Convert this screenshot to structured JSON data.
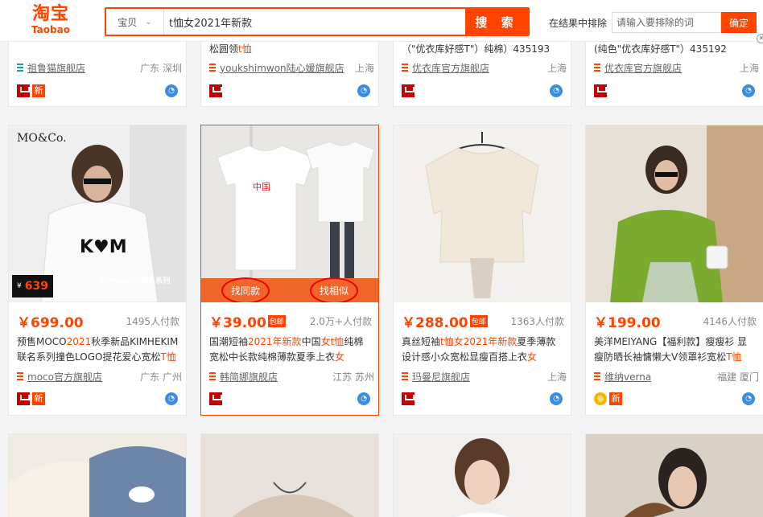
{
  "header": {
    "logo_cn": "淘宝",
    "logo_en": "Taobao",
    "search_category": "宝贝",
    "search_value": "t恤女2021年新款",
    "search_button": "搜 索",
    "exclude_label": "在结果中排除",
    "exclude_placeholder": "请输入要排除的词",
    "exclude_button": "确定"
  },
  "top_row": [
    {
      "line": "",
      "shop": "祖鲁猫旗舰店",
      "location": "广东 深圳"
    },
    {
      "line_a": "松圆领",
      "line_b": "t恤",
      "shop": "youkshimwon陆心媛旗舰店",
      "location": "上海"
    },
    {
      "line": "（\"优衣库好感T\"）纯棉）435193",
      "shop": "优衣库官方旗舰店",
      "location": "上海"
    },
    {
      "line": "(纯色\"优衣库好感T\"）435192",
      "shop": "优衣库官方旗舰店",
      "location": "上海"
    }
  ],
  "products": [
    {
      "price": "￥699.00",
      "deals": "1495人付款",
      "title_segments": [
        "预售MOCO",
        "2021",
        "秋季新品KIMHEKIM联名系列撞色LOGO提花爱心宽松",
        "T恤"
      ],
      "shop": "moco官方旗舰店",
      "location": "广东 广州",
      "brand": "MO&Co.",
      "promo_label": "KIMHEKIM联名系列",
      "promo_price": "639"
    },
    {
      "price": "￥39.00",
      "baoyou": "包邮",
      "deals": "2.0万+人付款",
      "title_segments": [
        "国潮短袖",
        "2021年新款",
        "中国",
        "女",
        "t恤",
        "纯棉宽松中长款纯棉薄款夏季上衣",
        "女"
      ],
      "shop": "韩简娜旗舰店",
      "location": "江苏 苏州",
      "find_same": "找同款",
      "find_similar": "找相似"
    },
    {
      "price": "￥288.00",
      "baoyou": "包邮",
      "deals": "1363人付款",
      "title_segments": [
        "真丝短袖",
        "t恤女2021年新款",
        "夏季薄款设计感小众宽松显瘦百搭上衣",
        "女"
      ],
      "shop": "玛曼尼旗舰店",
      "location": "上海"
    },
    {
      "price": "￥199.00",
      "deals": "4146人付款",
      "title_segments": [
        "美洋MEIYANG【福利款】瘦瘦衫 显瘦防晒长袖慵懒大V领罩衫宽松",
        "T恤"
      ],
      "shop": "维纳verna",
      "location": "福建 厦门"
    }
  ],
  "badges": {
    "new": "新"
  },
  "colors": {
    "accent": "#ff4400",
    "tmall": "#c40000",
    "link_gray": "#666666"
  }
}
